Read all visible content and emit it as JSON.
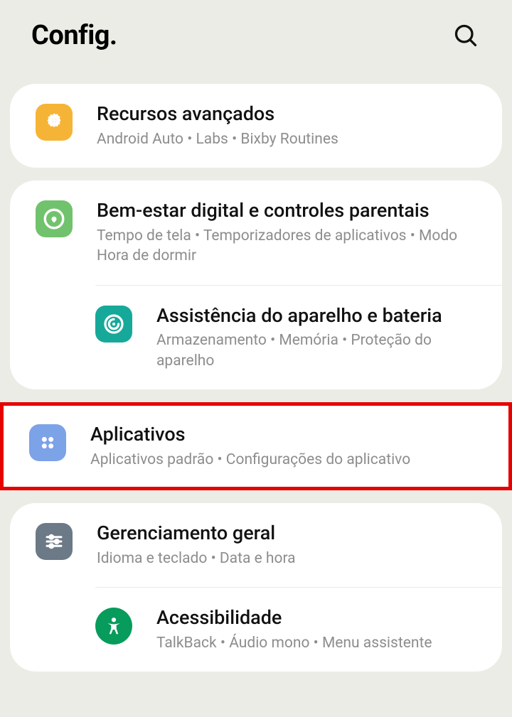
{
  "header": {
    "title": "Config."
  },
  "groups": [
    {
      "items": [
        {
          "title": "Recursos avançados",
          "subtitle": "Android Auto  •  Labs  •  Bixby Routines"
        }
      ]
    },
    {
      "items": [
        {
          "title": "Bem-estar digital e controles parentais",
          "subtitle": "Tempo de tela  •  Temporizadores de aplicativos  •  Modo Hora de dormir"
        },
        {
          "title": "Assistência do aparelho e bateria",
          "subtitle": "Armazenamento  •  Memória  •  Proteção do aparelho"
        }
      ]
    },
    {
      "highlight": true,
      "items": [
        {
          "title": "Aplicativos",
          "subtitle": "Aplicativos padrão  •  Configurações do aplicativo"
        }
      ]
    },
    {
      "items": [
        {
          "title": "Gerenciamento geral",
          "subtitle": "Idioma e teclado  •  Data e hora"
        },
        {
          "title": "Acessibilidade",
          "subtitle": "TalkBack  •  Áudio mono  •  Menu assistente"
        }
      ]
    }
  ]
}
